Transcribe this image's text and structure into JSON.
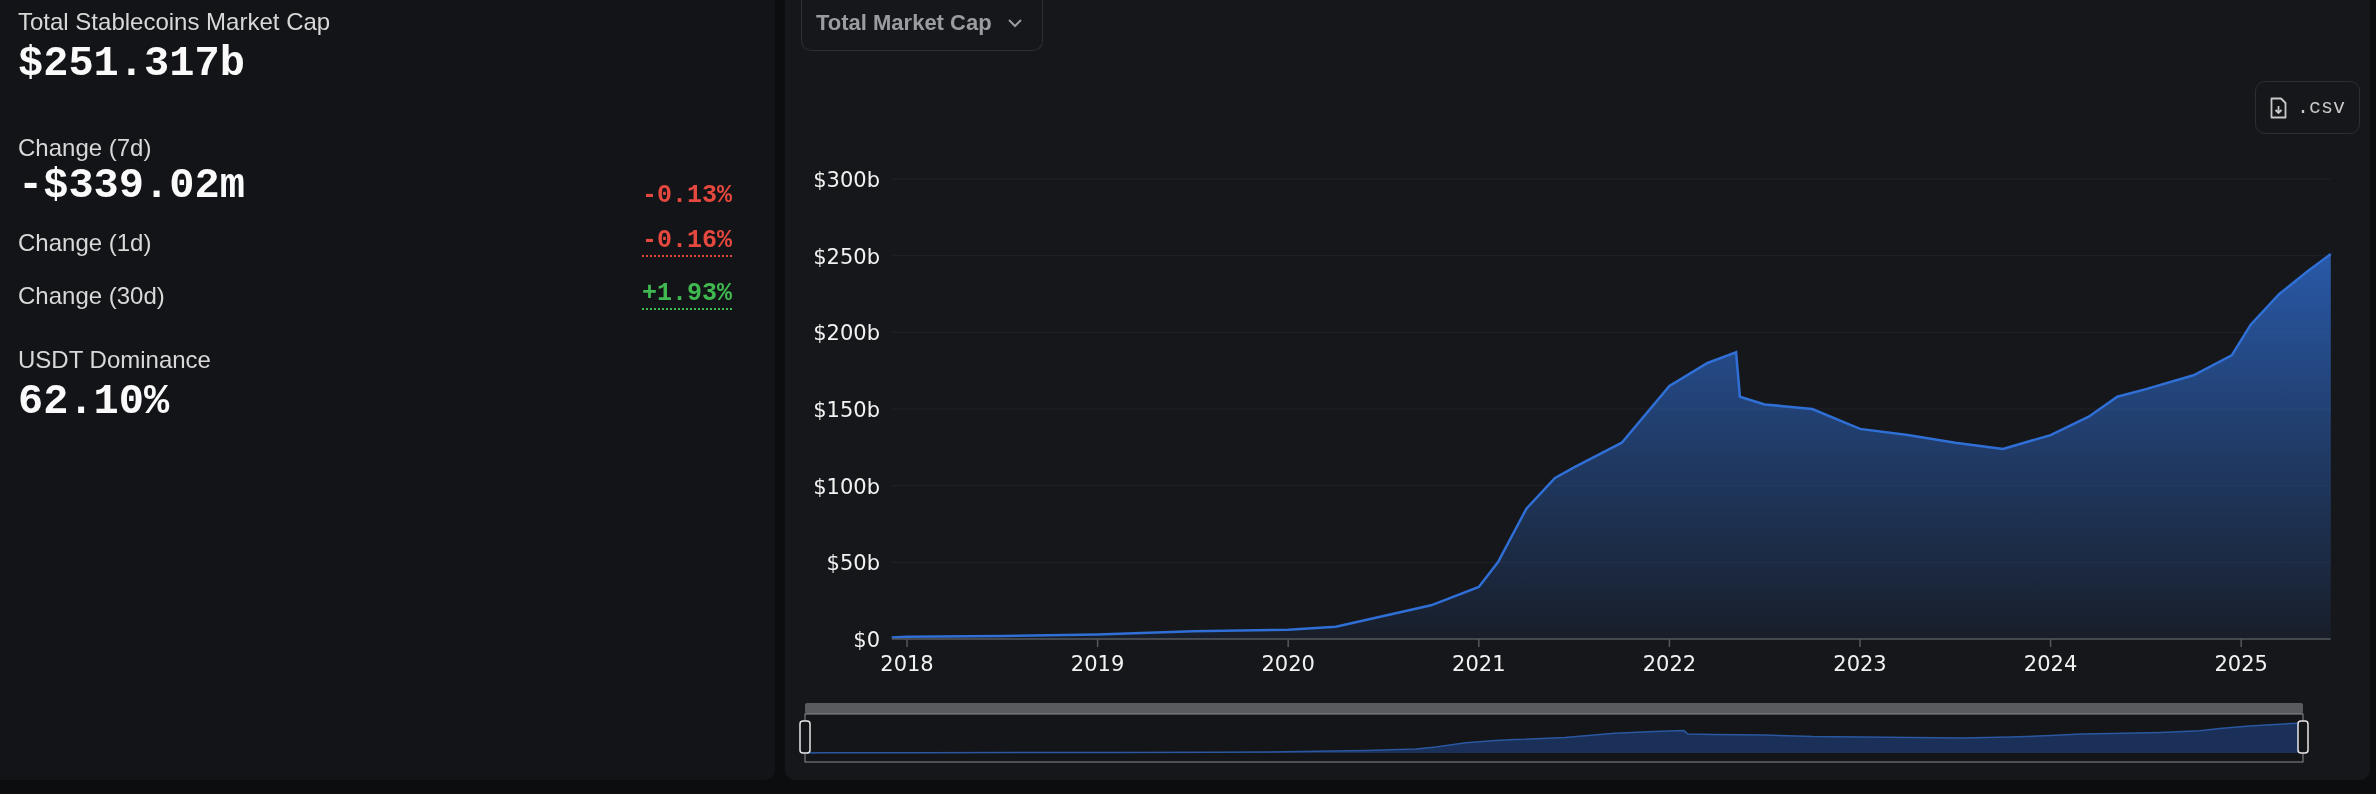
{
  "summary": {
    "title": "Total Stablecoins Market Cap",
    "value": "$251.317b"
  },
  "changes": [
    {
      "label": "Change (7d)",
      "amount": "-$339.02m",
      "percent": "-0.13%",
      "color": "#e5483f",
      "dotted": false
    },
    {
      "label": "Change (1d)",
      "percent": "-0.16%",
      "color": "#e5483f",
      "dotted": true
    },
    {
      "label": "Change (30d)",
      "percent": "+1.93%",
      "color": "#3fb950",
      "dotted": true
    }
  ],
  "dominance": {
    "label": "USDT Dominance",
    "value": "62.10%"
  },
  "chart_panel": {
    "dropdown": {
      "label": "Total Market Cap"
    },
    "csv_button": {
      "label": ".csv"
    },
    "chart_data": {
      "type": "area",
      "x": [
        2017.92,
        2018.0,
        2018.5,
        2019.0,
        2019.5,
        2020.0,
        2020.25,
        2020.5,
        2020.75,
        2021.0,
        2021.1,
        2021.25,
        2021.4,
        2021.5,
        2021.75,
        2022.0,
        2022.2,
        2022.35,
        2022.37,
        2022.5,
        2022.75,
        2023.0,
        2023.25,
        2023.5,
        2023.75,
        2024.0,
        2024.2,
        2024.35,
        2024.5,
        2024.75,
        2024.95,
        2025.05,
        2025.2,
        2025.35,
        2025.47
      ],
      "series": [
        {
          "color": "#2f6fd6",
          "values": [
            1,
            1.5,
            2,
            3,
            5,
            6,
            8,
            15,
            22,
            34,
            50,
            85,
            105,
            112,
            128,
            165,
            180,
            187,
            158,
            153,
            150,
            137,
            133,
            128,
            124,
            133,
            145,
            158,
            163,
            172,
            185,
            205,
            225,
            240,
            251
          ]
        }
      ],
      "xticks": [
        2018,
        2019,
        2020,
        2021,
        2022,
        2023,
        2024,
        2025
      ],
      "yticks": [
        {
          "value": 0,
          "label": "$0"
        },
        {
          "value": 50,
          "label": "$50b"
        },
        {
          "value": 100,
          "label": "$100b"
        },
        {
          "value": 150,
          "label": "$150b"
        },
        {
          "value": 200,
          "label": "$200b"
        },
        {
          "value": 250,
          "label": "$250b"
        },
        {
          "value": 300,
          "label": "$300b"
        }
      ],
      "xlim": [
        2017.92,
        2025.47
      ],
      "ylim": [
        0,
        300
      ],
      "grid": true
    }
  }
}
